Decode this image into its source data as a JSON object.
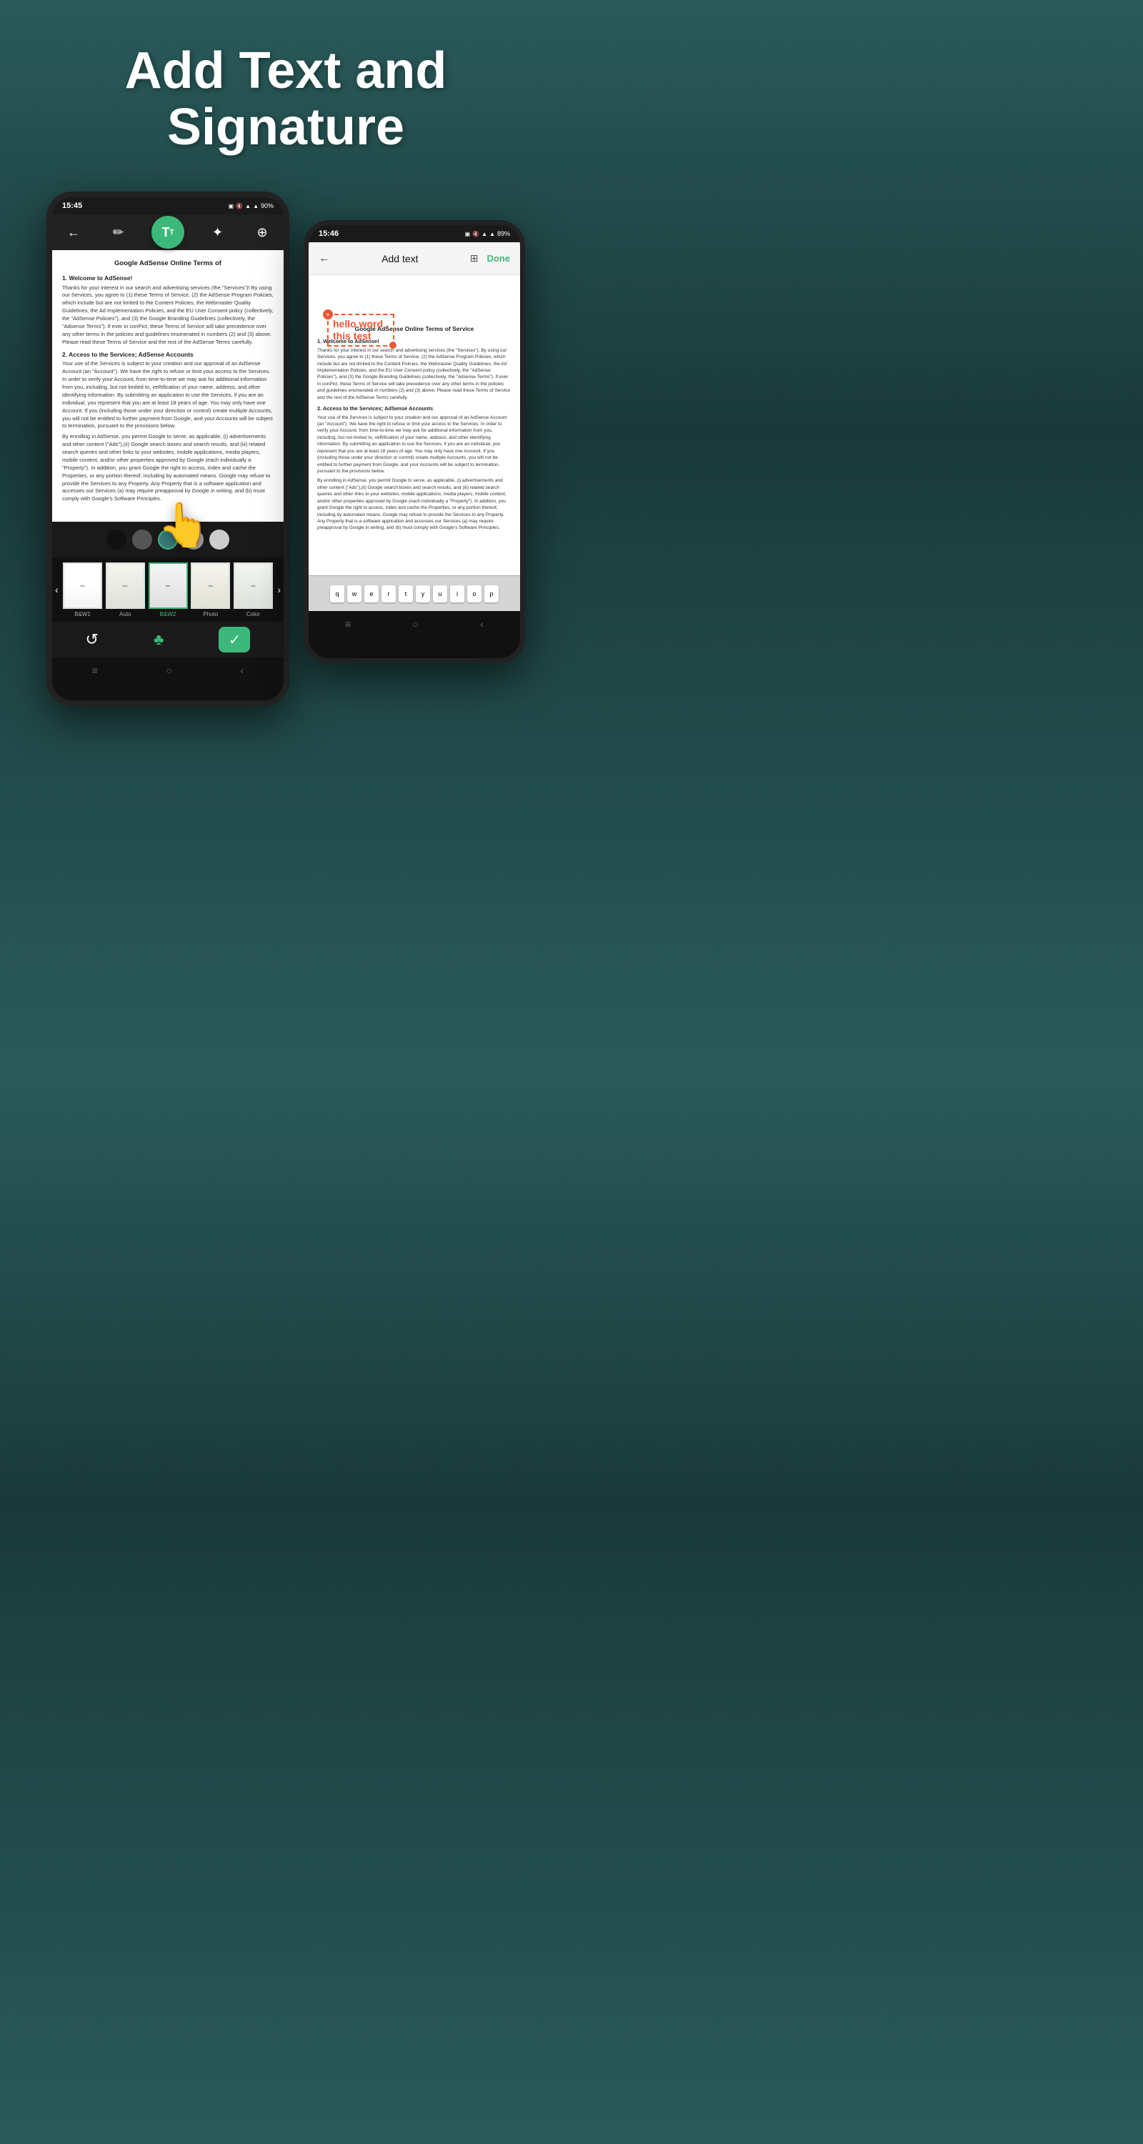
{
  "header": {
    "line1": "Add Text and",
    "line2": "Signature"
  },
  "phone_left": {
    "status_time": "15:45",
    "status_battery": "90%",
    "doc_title": "Google AdSense Online Terms of",
    "doc_section1_title": "1.   Welcome to AdSense!",
    "doc_section1_text": "Thanks for your interest in our search and advertising services (the \"Services\")! By using our Services, you agree to (1) these Terms of Service, (2) the AdSense Program Policies, which include but are not limited to the Content Policies, the Webmaster Quality Guidelines, the Ad Implementation Policies, and the EU User Consent policy (collectively, the \"AdSense Policies\"), and (3) the Google Branding Guidelines (collectively, the \"Adsense Terms\"). If ever in conPict, these Terms of Service will take precedence over any other terms in the policies and guidelines enumerated in numbers (2) and (3) above. Please read these Terms of Service and the rest of the AdSense Terms carefully.",
    "doc_section2_title": "2. Access to the Services; AdSense Accounts",
    "doc_section2_text": "Your use of the Services is subject to your creation and our approval of an AdSense Account (an \"Account\"). We have the right to refuse or limit your access to the Services. In order to verify your Account, from time-to-time we may ask for additional information from you, including, but not limited to, veRification of your name, address, and other identifying information. By submitting an application to use the Services, if you are an individual, you represent that you are at least 18 years of age. You may only have one Account. If you (including those under your direction or control) create multiple Accounts, you will not be entitled to further payment from Google, and your Accounts will be subject to termination, pursuant to the provisions below.",
    "doc_enroll_text": "By enrolling in AdSense, you permit Google to serve, as applicable, (i) advertisements and other content (\"Ads\"),(ii) Google search boxes and search results, and (iii) related search queries and other links to your websites, mobile applications, media players, mobile content, and/or other properties approved by Google (each individually a \"Property\"). In addition, you grant Google the right to access, index and cache the Properties, or any portion thereof, including by automated means. Google may refuse to provide the Services to any Property. Any Property that is a software application and accesses our Services (a) may require preapproval by Google in writing, and (b) must comply with Google's Software Principles.",
    "colors": [
      "#111111",
      "#555555",
      "#3a7a7a",
      "#aaaaaa",
      "#cccccc"
    ],
    "selected_color_index": 2,
    "filters": [
      "B&W1",
      "Auto",
      "B&W2",
      "Photo",
      "Color"
    ],
    "active_filter_index": 2
  },
  "phone_right": {
    "status_time": "15:46",
    "status_battery": "89%",
    "toolbar_title": "Add text",
    "toolbar_done": "Done",
    "overlay_text_line1": "hello word ,",
    "overlay_text_line2": "this test",
    "doc_title": "Google AdSense Online Terms of Service",
    "doc_section1_title": "1.   Welcome to AdSense!",
    "doc_text1": "Thanks for your interest in our search and advertising services (the \"Services\"). By using our Services, you agree to (1) these Terms of Service, (2) the AdSense Program Policies, which include but are not limited to the Content Policies, the Webmaster Quality Guidelines, the Ad Implementation Policies, and the EU User Consent policy (collectively, the \"AdSense Policies\"), and (3) the Google Branding Guidelines (collectively, the \"Adsense Terms\"). If ever in conPict, these Terms of Service will take precedence over any other terms in the policies and guidelines enumerated in numbers (2) and (3) above. Please read these Terms of Service and the rest of the AdSense Terms carefully.",
    "doc_section2_title": "2. Access to the Services; AdSense Accounts",
    "doc_text2": "Your use of the Services is subject to your creation and our approval of an AdSense Account (an \"Account\"). We have the right to refuse or limit your access to the Services. In order to verify your Account, from time-to-time we may ask for additional information from you, including, but not limited to, veRification of your name, address, and other identifying information. By submitting an application to use the Services, if you are an individual, you represent that you are at least 18 years of age. You may only have one Account. If you (including those under your direction or control) create multiple Accounts, you will not be entitled to further payment from Google, and your Accounts will be subject to termination, pursuant to the provisions below.",
    "doc_text3": "By enrolling in AdSense, you permit Google to serve, as applicable, (i) advertisements and other content (\"Ads\"),(ii) Google search boxes and search results, and (iii) related search queries and other links to your websites, mobile applications, media players, mobile content, and/or other properties approved by Google (each individually a \"Property\"). In addition, you grant Google the right to access, index and cache the Properties, or any portion thereof, including by automated means. Google may refuse to provide the Services to any Property. Any Property that is a software application and accesses our Services (a) may require preapproval by Google in writing, and (b) must comply with Google's Software Principles."
  },
  "icons": {
    "back": "←",
    "pen": "✏",
    "text": "T",
    "magic": "⟆",
    "search": "⊕",
    "refresh": "↺",
    "leaf": "☘",
    "check": "✓",
    "three_lines": "≡",
    "circle": "○",
    "chevron": "‹",
    "photo_plus": "🖼",
    "plus_square": "⊞"
  }
}
